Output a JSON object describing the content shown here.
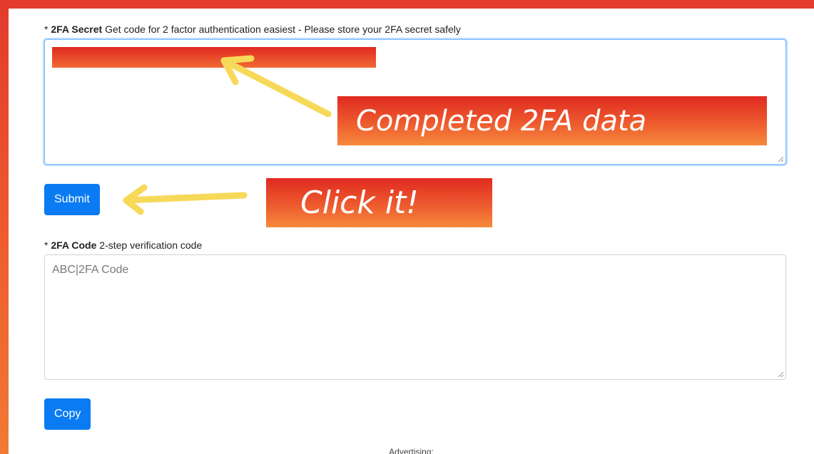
{
  "secret_field": {
    "required_marker": "* ",
    "label_bold": "2FA Secret",
    "label_desc": " Get code for 2 factor authentication easiest - Please store your 2FA secret safely"
  },
  "submit_button": {
    "label": "Submit"
  },
  "code_field": {
    "required_marker": "* ",
    "label_bold": "2FA Code",
    "label_desc": " 2-step verification code",
    "placeholder": "ABC|2FA Code"
  },
  "copy_button": {
    "label": "Copy"
  },
  "annotations": {
    "completed_callout": "Completed 2FA data",
    "click_callout": "Click it!"
  },
  "footer": {
    "advertising_label": "Advertising:"
  },
  "colors": {
    "accent": "#0a7bf3",
    "frame": "#e8402c",
    "arrow": "#f7d95a",
    "callout": "#e8402c"
  },
  "icons": [
    "arrow-icon",
    "resize-grip-icon"
  ]
}
